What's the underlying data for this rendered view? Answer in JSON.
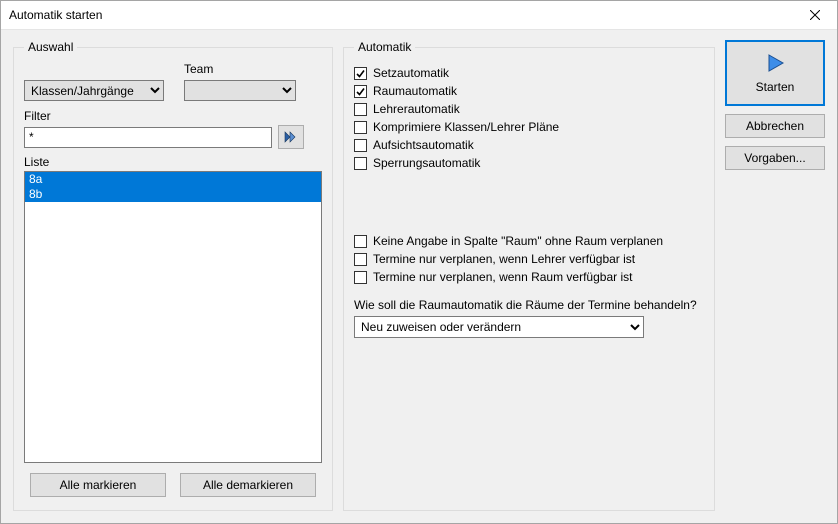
{
  "window": {
    "title": "Automatik starten"
  },
  "auswahl": {
    "legend": "Auswahl",
    "team_label": "Team",
    "scope_value": "Klassen/Jahrgänge",
    "team_value": "",
    "filter_label": "Filter",
    "filter_value": "*",
    "liste_label": "Liste",
    "items": [
      "8a",
      "8b"
    ],
    "btn_select_all": "Alle markieren",
    "btn_deselect_all": "Alle demarkieren"
  },
  "automatik": {
    "legend": "Automatik",
    "checks_top": [
      {
        "label": "Setzautomatik",
        "checked": true
      },
      {
        "label": "Raumautomatik",
        "checked": true
      },
      {
        "label": "Lehrerautomatik",
        "checked": false
      },
      {
        "label": "Komprimiere Klassen/Lehrer Pläne",
        "checked": false
      },
      {
        "label": "Aufsichtsautomatik",
        "checked": false
      },
      {
        "label": "Sperrungsautomatik",
        "checked": false
      }
    ],
    "checks_bottom": [
      {
        "label": "Keine Angabe in Spalte \"Raum\" ohne Raum verplanen",
        "checked": false
      },
      {
        "label": "Termine nur verplanen, wenn Lehrer verfügbar ist",
        "checked": false
      },
      {
        "label": "Termine nur verplanen, wenn Raum verfügbar ist",
        "checked": false
      }
    ],
    "room_question": "Wie soll die Raumautomatik die Räume der Termine behandeln?",
    "room_mode_value": "Neu zuweisen oder verändern"
  },
  "actions": {
    "start": "Starten",
    "cancel": "Abbrechen",
    "defaults": "Vorgaben..."
  },
  "icons": {
    "filter": "filter-apply-icon",
    "start": "play-icon",
    "close": "close-icon"
  }
}
